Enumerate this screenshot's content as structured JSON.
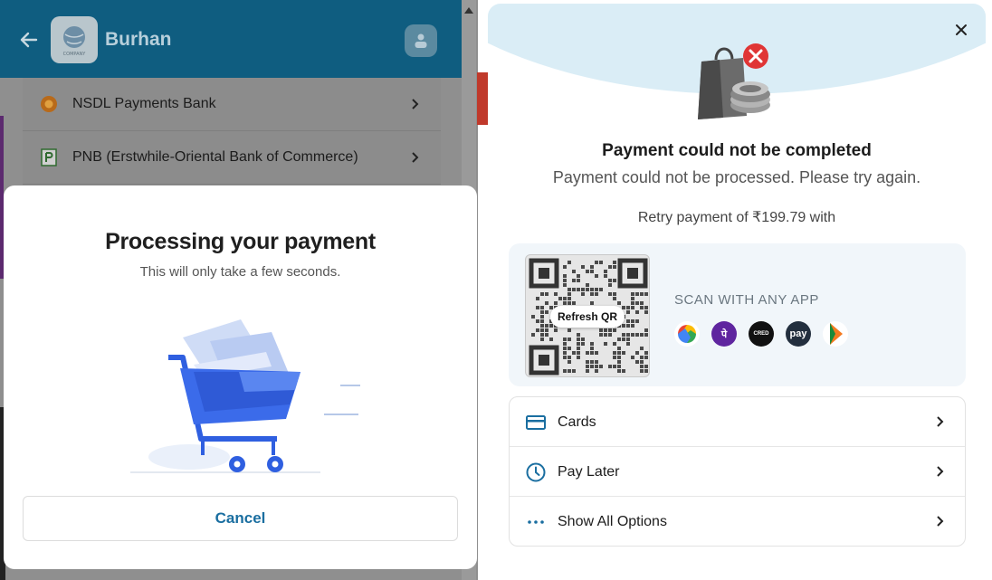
{
  "background_checkout": {
    "brand_name": "Burhan",
    "logo_text": "COMPANY",
    "banks": [
      {
        "name": "NSDL Payments Bank"
      },
      {
        "name": "PNB (Erstwhile-Oriental Bank of Commerce)"
      }
    ]
  },
  "processing_modal": {
    "title": "Processing your payment",
    "subtitle": "This will only take a few seconds.",
    "cancel_label": "Cancel"
  },
  "failure_panel": {
    "title": "Payment could not be completed",
    "subtitle": "Payment could not be processed. Please try again.",
    "retry_text": "Retry payment of ₹199.79 with",
    "qr": {
      "refresh_label": "Refresh QR",
      "scan_label": "SCAN WITH ANY APP",
      "apps": [
        {
          "name": "google-pay-icon"
        },
        {
          "name": "phonepe-icon",
          "glyph": "पे"
        },
        {
          "name": "cred-icon",
          "glyph": "CRED"
        },
        {
          "name": "amazon-pay-icon",
          "glyph": "pay"
        },
        {
          "name": "bhim-icon"
        }
      ]
    },
    "options": [
      {
        "label": "Cards",
        "icon": "card-icon"
      },
      {
        "label": "Pay Later",
        "icon": "clock-icon"
      },
      {
        "label": "Show All Options",
        "icon": "more-dots-icon"
      }
    ]
  },
  "colors": {
    "header_blue": "#0f5d80",
    "accent_blue": "#1a6ea0",
    "cart_blue": "#2f5fe0",
    "failure_red": "#e03535",
    "arc_blue": "#daedf6"
  }
}
